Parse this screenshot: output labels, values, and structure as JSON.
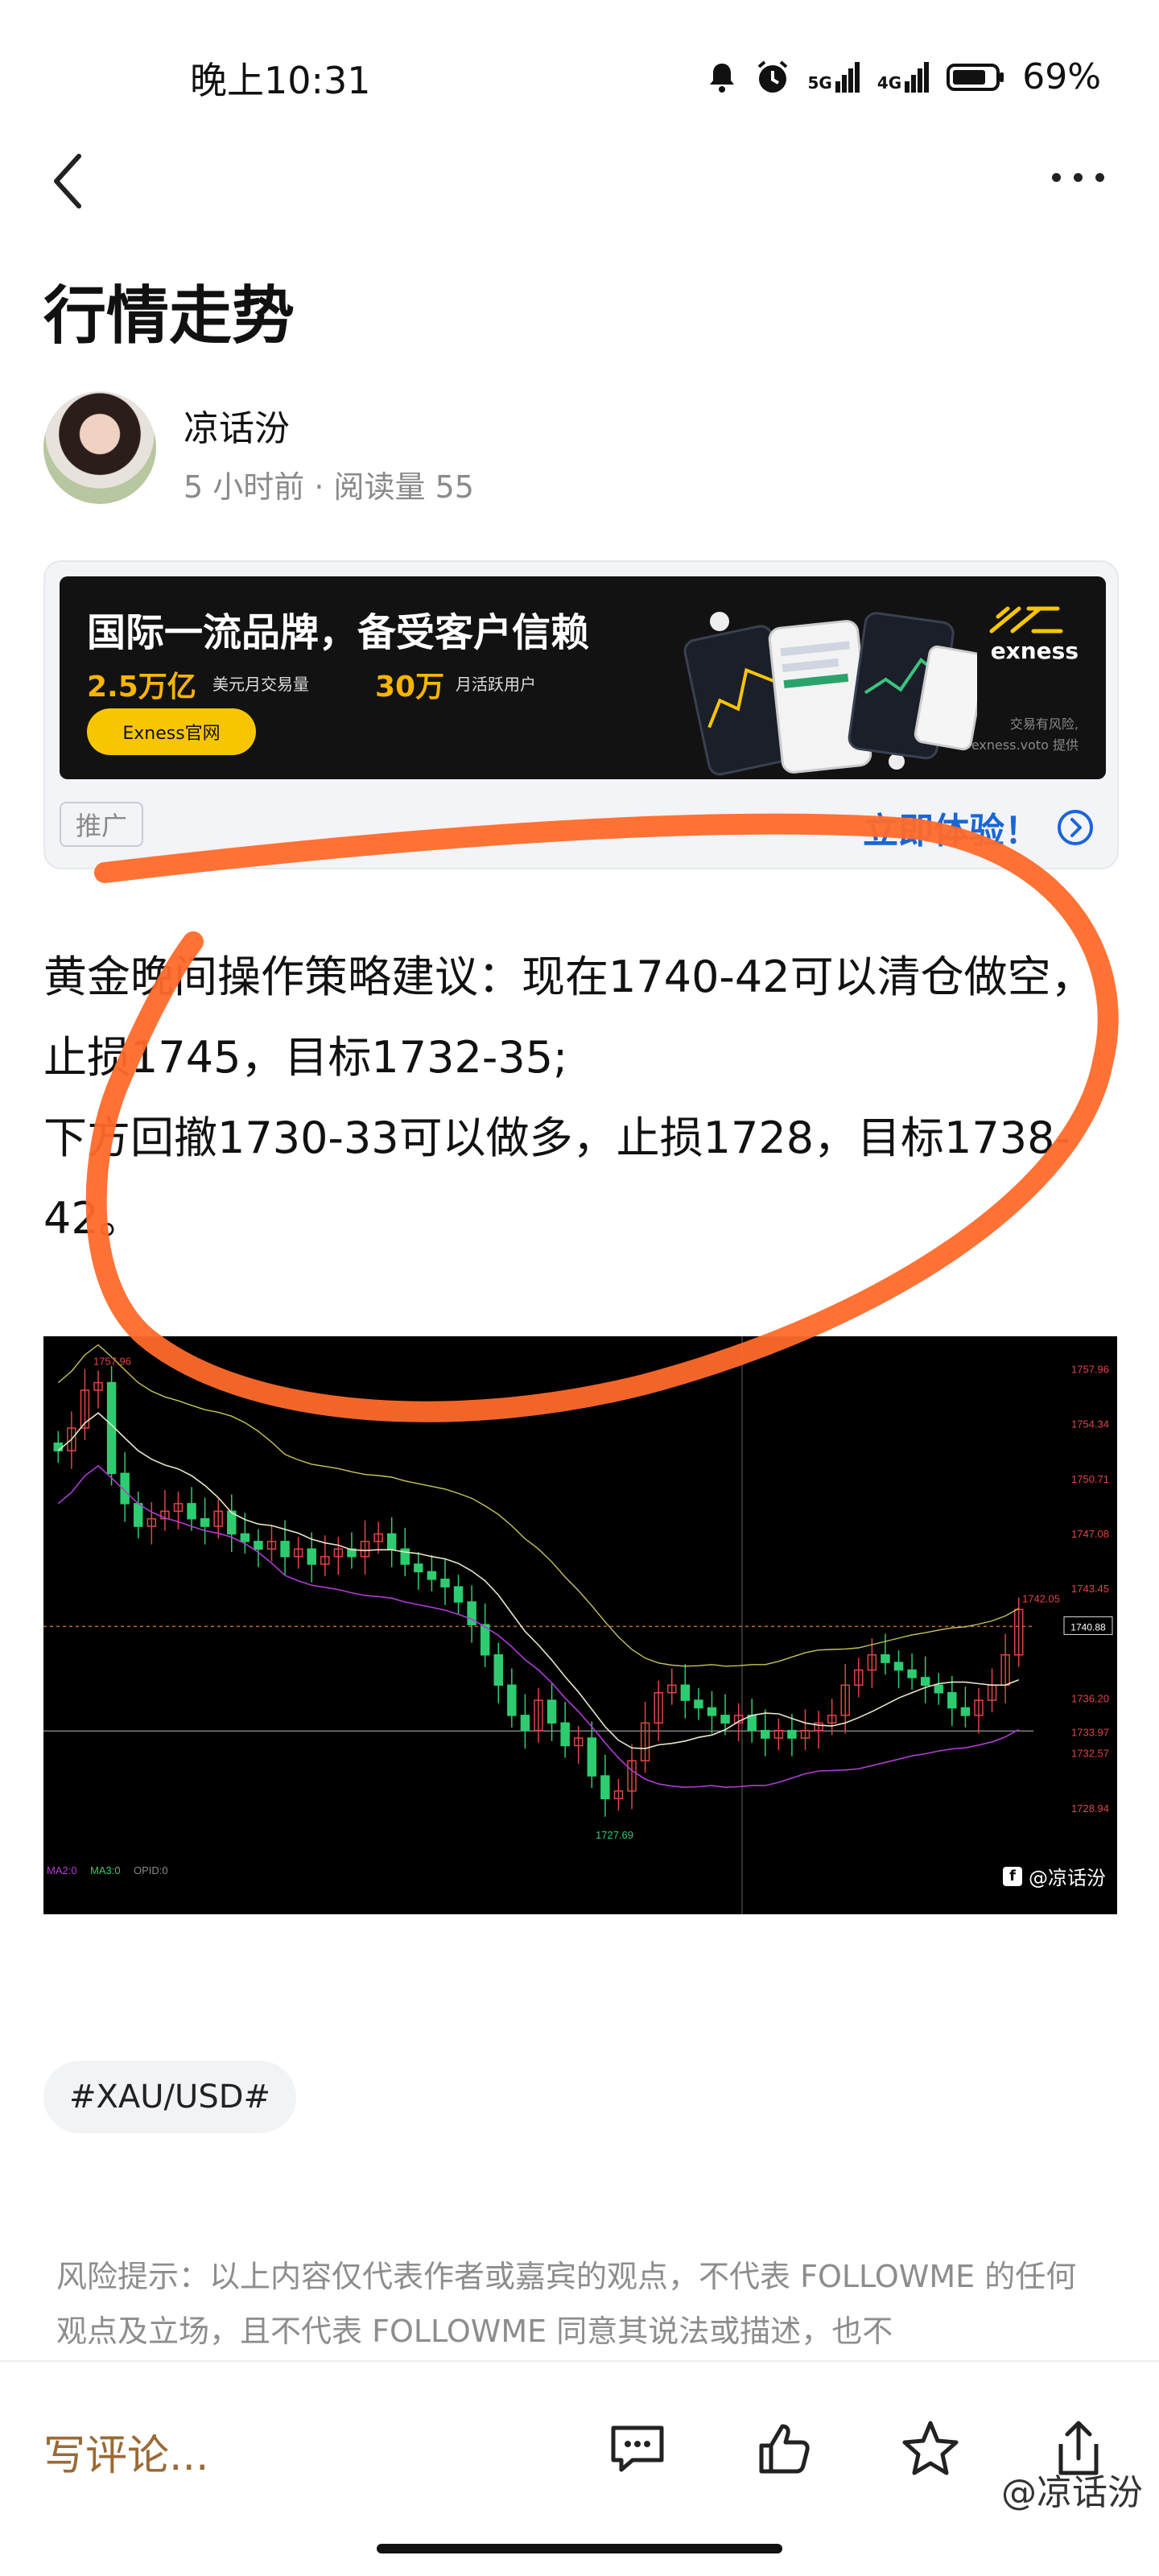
{
  "status_bar": {
    "time": "晚上10:31",
    "network1": "5G",
    "network2": "4G",
    "battery": "69%"
  },
  "header": {
    "title": "行情走势"
  },
  "author": {
    "name": "凉话汾",
    "meta": "5 小时前 · 阅读量 55"
  },
  "ad": {
    "headline": "国际一流品牌，备受客户信赖",
    "stat1_value": "2.5万亿",
    "stat1_label": "美元月交易量",
    "stat2_value": "30万",
    "stat2_label": "月活跃用户",
    "cta": "Exness官网",
    "logo": "exness",
    "risk_note": "交易有风险,",
    "provider": "exness.voto 提供",
    "tag": "推广",
    "link_text": "立即体验！"
  },
  "content": {
    "line1": "黄金晚间操作策略建议：现在1740-42可以清仓做空，止损1745，目标1732-35;",
    "line2": "下方回撤1730-33可以做多，止损1728，目标1738-42。"
  },
  "chart_data": {
    "type": "line",
    "price_labels": [
      "1757.96",
      "1754.34",
      "1750.71",
      "1747.08",
      "1743.45",
      "1740.88",
      "1736.20",
      "1733.97",
      "1732.57",
      "1728.94"
    ],
    "high_label": "1757.96",
    "low_label": "1727.69",
    "last_label": "1742.05",
    "current_label": "1740.88",
    "indicator_labels": [
      "MA2:0",
      "MA3:0",
      "OPID:0"
    ],
    "watermark": "@凉话汾",
    "closes": [
      1752.5,
      1754.0,
      1756.5,
      1757.0,
      1751.0,
      1749.0,
      1747.5,
      1748.0,
      1748.5,
      1749.0,
      1748.0,
      1747.5,
      1748.5,
      1747.0,
      1746.5,
      1746.0,
      1746.5,
      1745.5,
      1746.0,
      1745.0,
      1745.5,
      1746.0,
      1745.5,
      1746.5,
      1747.0,
      1746.0,
      1745.0,
      1744.5,
      1744.0,
      1743.5,
      1742.5,
      1741.0,
      1739.0,
      1737.0,
      1735.0,
      1734.0,
      1736.0,
      1734.5,
      1733.0,
      1733.5,
      1731.0,
      1729.5,
      1730.0,
      1732.0,
      1734.5,
      1736.5,
      1737.0,
      1736.0,
      1735.5,
      1735.0,
      1734.5,
      1735.0,
      1734.0,
      1733.5,
      1734.0,
      1733.5,
      1734.0,
      1734.5,
      1735.0,
      1737.0,
      1738.0,
      1739.0,
      1738.5,
      1738.0,
      1737.5,
      1737.0,
      1736.5,
      1735.5,
      1735.0,
      1736.0,
      1737.0,
      1739.0,
      1742.0
    ]
  },
  "hashtag": "#XAU/USD#",
  "disclaimer": "风险提示：以上内容仅代表作者或嘉宾的观点，不代表 FOLLOWME 的任何观点及立场，且不代表 FOLLOWME 同意其说法或描述，也不",
  "bottom_bar": {
    "comment_placeholder": "写评论...",
    "watermark": "@凉话汾"
  }
}
